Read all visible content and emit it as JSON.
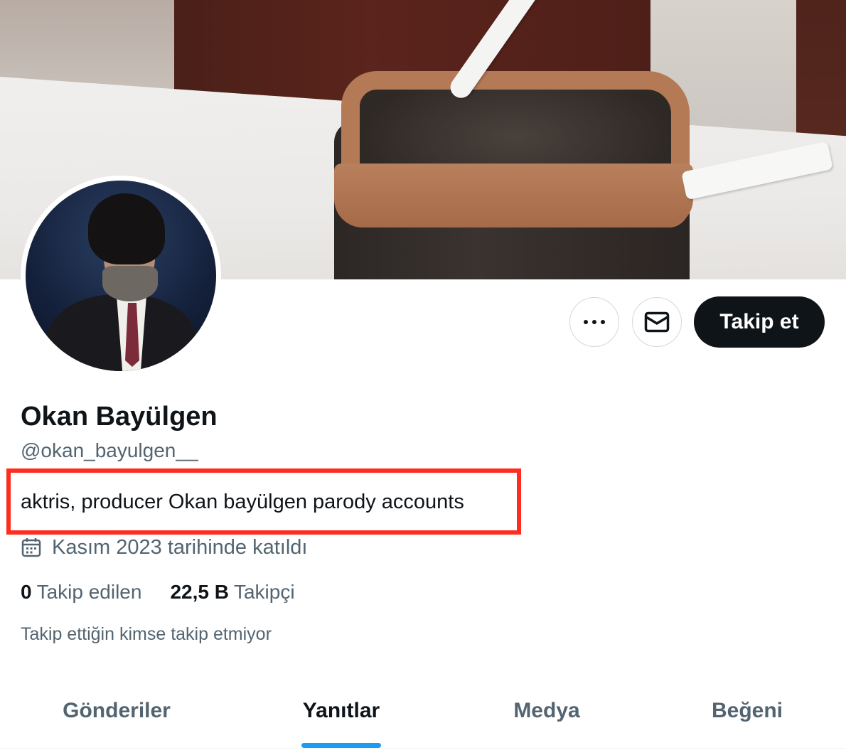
{
  "profile": {
    "name": "Okan Bayülgen",
    "handle": "@okan_bayulgen__",
    "bio": "aktris, producer Okan bayülgen parody accounts",
    "joined": "Kasım 2023 tarihinde katıldı",
    "following_count": "0",
    "following_label": "Takip edilen",
    "followers_count": "22,5 B",
    "followers_label": "Takipçi",
    "followed_by_note": "Takip ettiğin kimse takip etmiyor"
  },
  "actions": {
    "more_icon": "more-dots-icon",
    "message_icon": "envelope-icon",
    "follow_label": "Takip et"
  },
  "tabs": [
    {
      "label": "Gönderiler",
      "active": false
    },
    {
      "label": "Yanıtlar",
      "active": true
    },
    {
      "label": "Medya",
      "active": false
    },
    {
      "label": "Beğeni",
      "active": false
    }
  ],
  "colors": {
    "accent": "#1d9bf0",
    "highlight_box": "#ff2d1f",
    "text_primary": "#0f1419",
    "text_secondary": "#536471",
    "follow_button_bg": "#0f1419"
  }
}
